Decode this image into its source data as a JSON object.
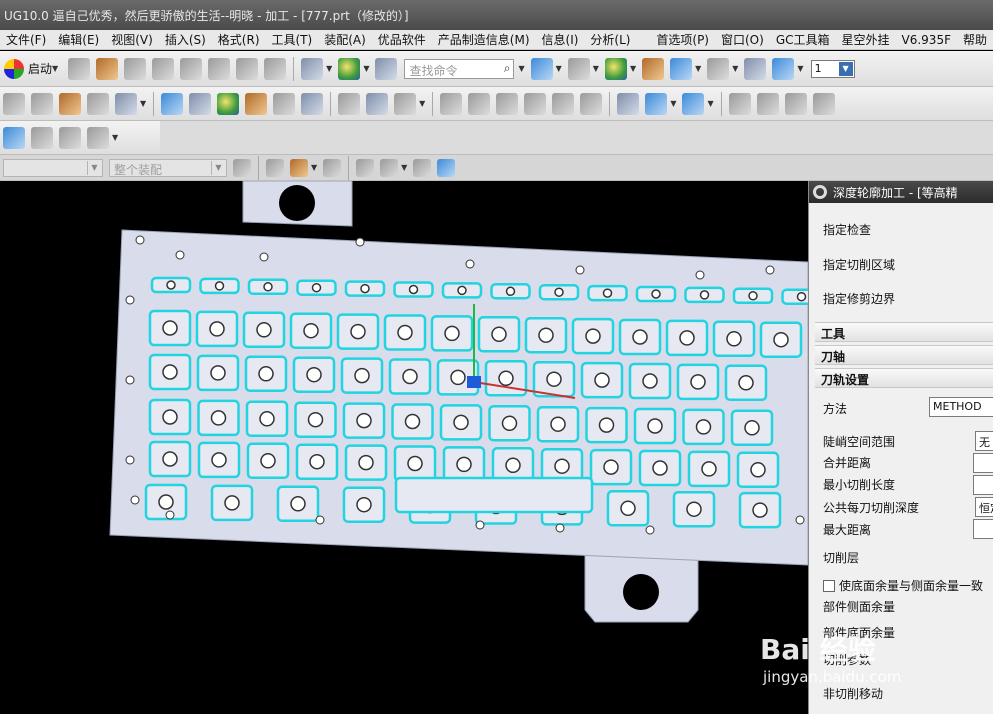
{
  "window": {
    "title": "UG10.0 逼自己优秀，然后更骄傲的生活--明晓 - 加工 - [777.prt（修改的）]"
  },
  "menu": {
    "items": [
      "文件(F)",
      "编辑(E)",
      "视图(V)",
      "插入(S)",
      "格式(R)",
      "工具(T)",
      "装配(A)",
      "优品软件",
      "产品制造信息(M)",
      "信息(I)",
      "分析(L)"
    ],
    "right_items": [
      "首选项(P)",
      "窗口(O)",
      "GC工具箱",
      "星空外挂",
      "V6.935F",
      "帮助"
    ]
  },
  "toolbar": {
    "start_label": "启动",
    "search_placeholder": "查找命令",
    "select_value": "1"
  },
  "filter_bar": {
    "filter_value": "",
    "assembly_value": "整个装配"
  },
  "panel": {
    "title": "深度轮廓加工 - [等高精",
    "rows": [
      "指定检查",
      "指定切削区域",
      "指定修剪边界"
    ],
    "sections": [
      "工具",
      "刀轴",
      "刀轨设置"
    ],
    "method_label": "方法",
    "method_value": "METHOD",
    "steep_label": "陡峭空间范围",
    "steep_value": "无",
    "merge_label": "合并距离",
    "min_cut_label": "最小切削长度",
    "depth_label": "公共每刀切削深度",
    "depth_value": "恒定",
    "max_dist_label": "最大距离",
    "cut_layers_label": "切削层",
    "floor_same_label": "使底面余量与侧面余量一致",
    "part_side_label": "部件侧面余量",
    "part_floor_label": "部件底面余量",
    "cut_params_label": "切削参数",
    "non_cut_label": "非切削移动"
  },
  "watermark": {
    "brand": "Bai 经验",
    "url": "jingyan.baidu.com"
  },
  "colors": {
    "accent": "#3b6db3",
    "toolpath": "#22d3e0",
    "plate": "#d8dceb"
  }
}
